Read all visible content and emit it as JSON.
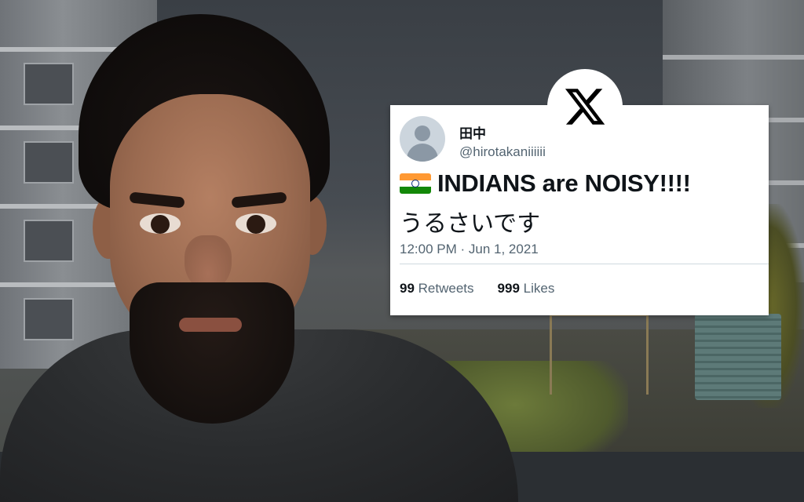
{
  "tweet": {
    "display_name": "田中",
    "handle": "@hirotakaniiiiii",
    "headline": "INDIANS are NOISY!!!!",
    "flag_icon": "india-flag-icon",
    "japanese_text": "うるさいです",
    "timestamp": "12:00 PM · Jun 1, 2021",
    "retweets_count": "99",
    "retweets_label": "Retweets",
    "likes_count": "999",
    "likes_label": "Likes"
  },
  "badge": {
    "icon": "x-logo-icon"
  },
  "colors": {
    "text_primary": "#0f1419",
    "text_secondary": "#536471",
    "divider": "#cfd9de",
    "flag_saffron": "#ff9933",
    "flag_white": "#ffffff",
    "flag_green": "#138808"
  }
}
